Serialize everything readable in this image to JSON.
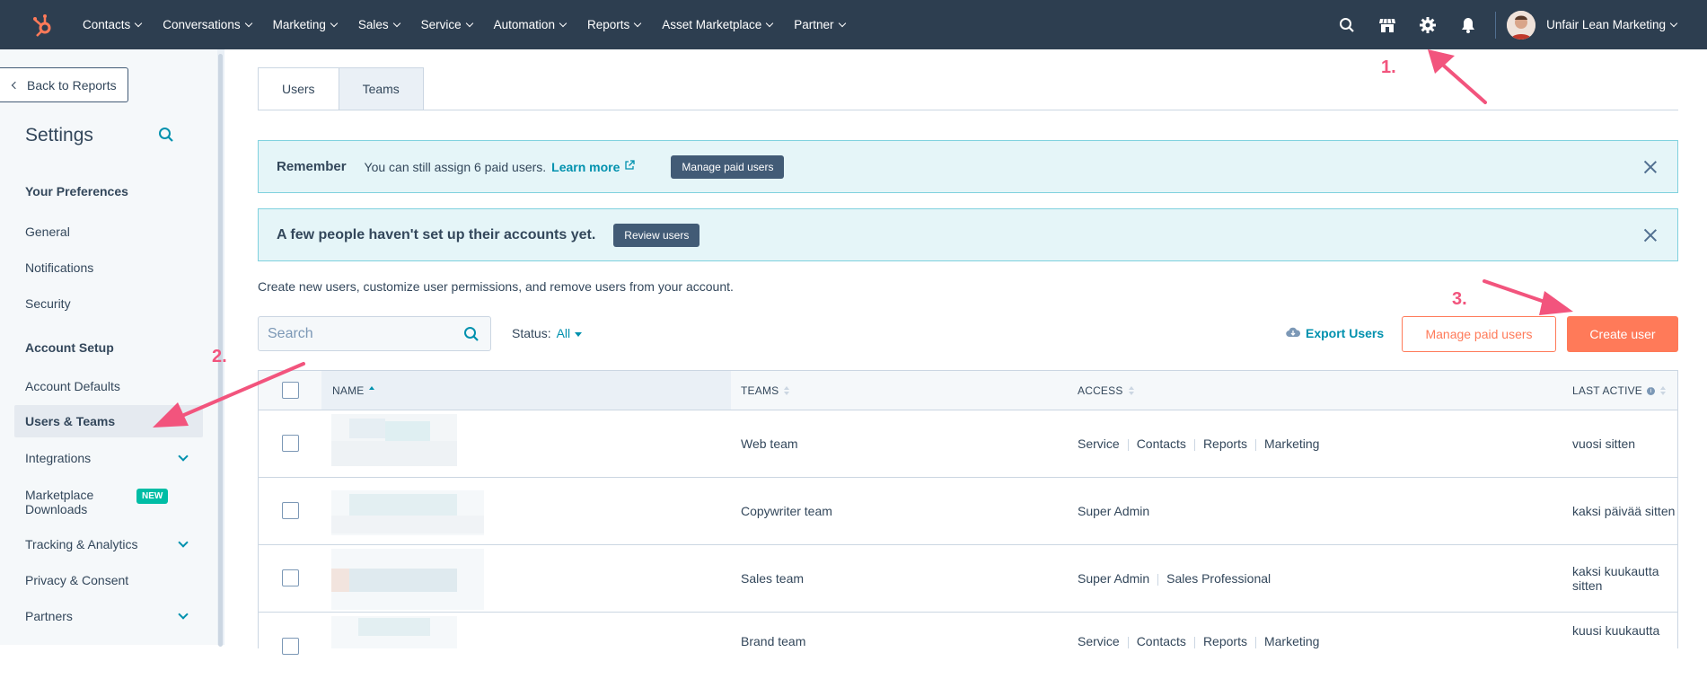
{
  "topnav": {
    "menu": [
      "Contacts",
      "Conversations",
      "Marketing",
      "Sales",
      "Service",
      "Automation",
      "Reports",
      "Asset Marketplace",
      "Partner"
    ],
    "account_name": "Unfair Lean Marketing",
    "icons": [
      "hubspot-logo",
      "search-icon",
      "marketplace-icon",
      "gear-icon",
      "bell-icon"
    ]
  },
  "sidebar": {
    "back_label": "Back to Reports",
    "title": "Settings",
    "section_preferences": "Your Preferences",
    "item_general": "General",
    "item_notifications": "Notifications",
    "item_security": "Security",
    "section_account": "Account Setup",
    "item_account_defaults": "Account Defaults",
    "item_users_teams": "Users & Teams",
    "item_integrations": "Integrations",
    "item_marketplace": "Marketplace Downloads",
    "badge_new": "NEW",
    "item_tracking": "Tracking & Analytics",
    "item_privacy": "Privacy & Consent",
    "item_partners": "Partners"
  },
  "tabs": {
    "users": "Users",
    "teams": "Teams"
  },
  "alert_remember": {
    "title": "Remember",
    "text": "You can still assign 6 paid users.",
    "link": "Learn more",
    "button": "Manage paid users"
  },
  "alert_setup": {
    "title": "A few people haven't set up their accounts yet.",
    "button": "Review users"
  },
  "description": "Create new users, customize user permissions, and remove users from your account.",
  "search": {
    "placeholder": "Search"
  },
  "status": {
    "label": "Status:",
    "value": "All"
  },
  "actions": {
    "export": "Export Users",
    "manage_paid": "Manage paid users",
    "create_user": "Create user"
  },
  "table": {
    "headers": {
      "name": "NAME",
      "teams": "TEAMS",
      "access": "ACCESS",
      "last_active": "LAST ACTIVE"
    },
    "rows": [
      {
        "team": "Web team",
        "access": [
          "Service",
          "Contacts",
          "Reports",
          "Marketing"
        ],
        "last_active": "vuosi sitten"
      },
      {
        "team": "Copywriter team",
        "access": [
          "Super Admin"
        ],
        "last_active": "kaksi päivää sitten"
      },
      {
        "team": "Sales team",
        "access": [
          "Super Admin",
          "Sales Professional"
        ],
        "last_active": "kaksi kuukautta sitten"
      },
      {
        "team": "Brand team",
        "access": [
          "Service",
          "Contacts",
          "Reports",
          "Marketing"
        ],
        "last_active": "kuusi kuukautta"
      }
    ]
  },
  "annotations": {
    "step1": "1.",
    "step2": "2.",
    "step3": "3."
  },
  "colors": {
    "nav_bg": "#2d3e50",
    "accent": "#ff7a59",
    "link": "#0091ae",
    "annotation": "#f2547d"
  }
}
